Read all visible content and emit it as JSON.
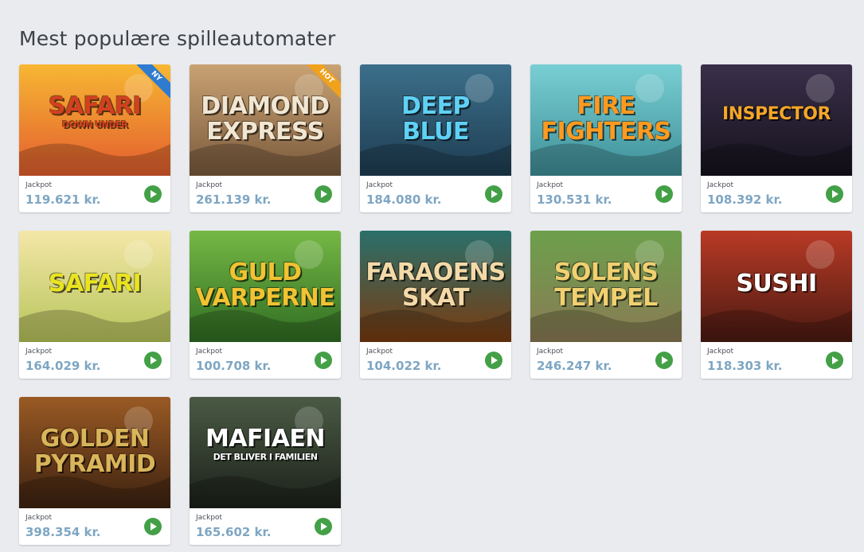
{
  "section": {
    "title": "Mest populære spilleautomater"
  },
  "games": [
    {
      "name": "Safari Down Under",
      "art_lines": [
        "SAFARI",
        "DOWN UNDER"
      ],
      "badge": "NY",
      "jackpot_label": "Jackpot",
      "amount": "119.621 kr.",
      "bg": [
        "#f7b733",
        "#e35d2e"
      ],
      "text_color": "#d2401f"
    },
    {
      "name": "Diamond Express",
      "art_lines": [
        "DIAMOND",
        "EXPRESS"
      ],
      "badge": "HOT",
      "jackpot_label": "Jackpot",
      "amount": "261.139 kr.",
      "bg": [
        "#c9a273",
        "#7a5a3c"
      ],
      "text_color": "#f1e6d2"
    },
    {
      "name": "Deep Blue",
      "art_lines": [
        "DEEP",
        "BLUE"
      ],
      "badge": "",
      "jackpot_label": "Jackpot",
      "amount": "184.080 kr.",
      "bg": [
        "#3c6f8a",
        "#1e3d52"
      ],
      "text_color": "#5fd1f5"
    },
    {
      "name": "Fire Fighters",
      "art_lines": [
        "FIRE",
        "FIGHTERS"
      ],
      "badge": "",
      "jackpot_label": "Jackpot",
      "amount": "130.531 kr.",
      "bg": [
        "#78cfd3",
        "#3f8f98"
      ],
      "text_color": "#ff9a1f"
    },
    {
      "name": "Inspector",
      "art_lines": [
        "INSPECTOR"
      ],
      "badge": "",
      "jackpot_label": "Jackpot",
      "amount": "108.392 kr.",
      "bg": [
        "#3a2f4a",
        "#15121c"
      ],
      "text_color": "#f3a62a"
    },
    {
      "name": "Safari",
      "art_lines": [
        "SAFARI"
      ],
      "badge": "",
      "jackpot_label": "Jackpot",
      "amount": "164.029 kr.",
      "bg": [
        "#f4e7a8",
        "#b7c45a"
      ],
      "text_color": "#e9e41f"
    },
    {
      "name": "Guld Varperne",
      "art_lines": [
        "GULD",
        "VARPERNE"
      ],
      "badge": "",
      "jackpot_label": "Jackpot",
      "amount": "100.708 kr.",
      "bg": [
        "#76b845",
        "#2f6d22"
      ],
      "text_color": "#f1c232"
    },
    {
      "name": "Faraoens Skat",
      "art_lines": [
        "FARAOENS",
        "SKAT"
      ],
      "badge": "",
      "jackpot_label": "Jackpot",
      "amount": "104.022 kr.",
      "bg": [
        "#2a6f6a",
        "#7a3b10"
      ],
      "text_color": "#f4d9a8"
    },
    {
      "name": "Solens Tempel",
      "art_lines": [
        "SOLENS",
        "TEMPEL"
      ],
      "badge": "",
      "jackpot_label": "Jackpot",
      "amount": "246.247 kr.",
      "bg": [
        "#6ca04b",
        "#8a7a55"
      ],
      "text_color": "#f0d070"
    },
    {
      "name": "Sushi",
      "art_lines": [
        "SUSHI"
      ],
      "badge": "",
      "jackpot_label": "Jackpot",
      "amount": "118.303 kr.",
      "bg": [
        "#b93a25",
        "#4a1a12"
      ],
      "text_color": "#ffffff"
    },
    {
      "name": "Golden Pyramid",
      "art_lines": [
        "GOLDEN",
        "PYRAMID"
      ],
      "badge": "",
      "jackpot_label": "Jackpot",
      "amount": "398.354 kr.",
      "bg": [
        "#9a5a24",
        "#3d2210"
      ],
      "text_color": "#d9b55a"
    },
    {
      "name": "Mafiaen",
      "art_lines": [
        "MAFIAEN",
        "DET BLIVER I FAMILIEN"
      ],
      "badge": "",
      "jackpot_label": "Jackpot",
      "amount": "165.602 kr.",
      "bg": [
        "#4a5a44",
        "#1c211a"
      ],
      "text_color": "#ffffff"
    }
  ],
  "badge_colors": {
    "NY": "#2f7bd0",
    "HOT": "#f0a21c"
  },
  "colors": {
    "play": "#43a047",
    "amount": "#7ea6c3",
    "page_bg": "#e9ebef"
  }
}
